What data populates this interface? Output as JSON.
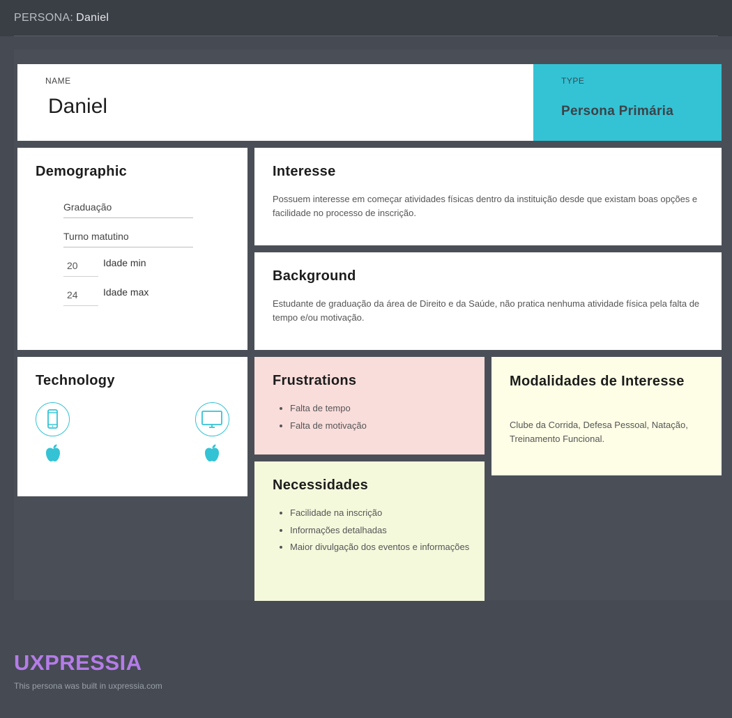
{
  "header": {
    "label": "PERSONA:",
    "name": "Daniel"
  },
  "name_card": {
    "label": "NAME",
    "value": "Daniel"
  },
  "type_card": {
    "label": "TYPE",
    "value": "Persona Primária",
    "color": "#33c3d5"
  },
  "demographic": {
    "title": "Demographic",
    "fields": [
      "Graduação",
      "Turno matutino"
    ],
    "age_min": {
      "value": "20",
      "label": "Idade min"
    },
    "age_max": {
      "value": "24",
      "label": "Idade max"
    }
  },
  "interesse": {
    "title": "Interesse",
    "text": "Possuem interesse em começar atividades físicas dentro da instituição desde que existam boas opções e facilidade no processo de inscrição."
  },
  "background": {
    "title": "Background",
    "text": "Estudante de graduação da área de Direito e da Saúde, não pratica nenhuma atividade física pela falta de tempo e/ou motivação."
  },
  "technology": {
    "title": "Technology",
    "devices": [
      {
        "icon": "smartphone-icon",
        "os_icon": "apple-icon"
      },
      {
        "icon": "desktop-icon",
        "os_icon": "apple-icon"
      }
    ]
  },
  "frustrations": {
    "title": "Frustrations",
    "items": [
      "Falta de tempo",
      "Falta de motivação"
    ],
    "color": "#f9dddb"
  },
  "necessidades": {
    "title": "Necessidades",
    "items": [
      "Facilidade na inscrição",
      "Informações detalhadas",
      "Maior divulgação dos eventos e informações"
    ],
    "color": "#f5f9dc"
  },
  "modalidades": {
    "title": "Modalidades de Interesse",
    "text": "Clube da Corrida, Defesa Pessoal, Natação, Treinamento Funcional.",
    "color": "#fefee6"
  },
  "footer": {
    "brand": "UXPRESSIA",
    "note": "This persona was built in uxpressia.com",
    "brand_color": "#b57ce8"
  }
}
